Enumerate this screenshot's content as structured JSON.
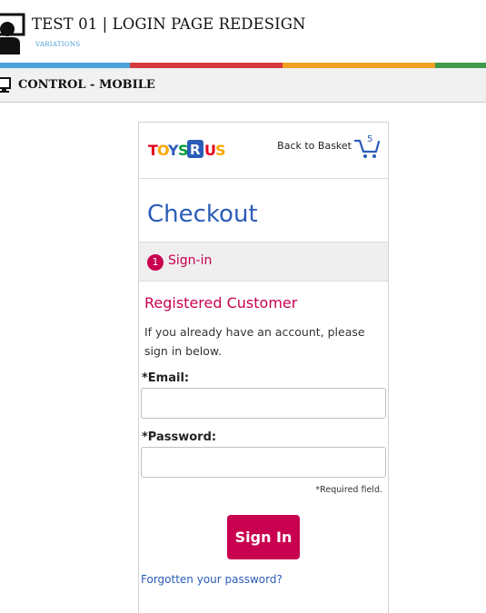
{
  "header": {
    "title": "TEST 01 | LOGIN PAGE REDESIGN",
    "subtitle": "VARIATIONS",
    "stripe_colors": [
      "#4aa3d9",
      "#d63a3f",
      "#f0a023",
      "#3f9a4a"
    ]
  },
  "variant_bar": {
    "icon": "monitor-icon",
    "title": "CONTROL - MOBILE"
  },
  "site": {
    "logo": "TOYSRUS",
    "back_to_basket": "Back to Basket",
    "basket_count": "5",
    "checkout_title": "Checkout",
    "step": {
      "number": "1",
      "label": "Sign-in"
    },
    "section_title": "Registered Customer",
    "intro": "If you already have an account, please sign in below.",
    "email_label": "*Email:",
    "email_value": "",
    "password_label": "*Password:",
    "password_value": "",
    "required_note": "*Required field.",
    "signin_button": "Sign In",
    "forgot_link": "Forgotten your password?",
    "brand_colors": {
      "pink": "#c8004f",
      "blue": "#2a5cb8"
    }
  }
}
